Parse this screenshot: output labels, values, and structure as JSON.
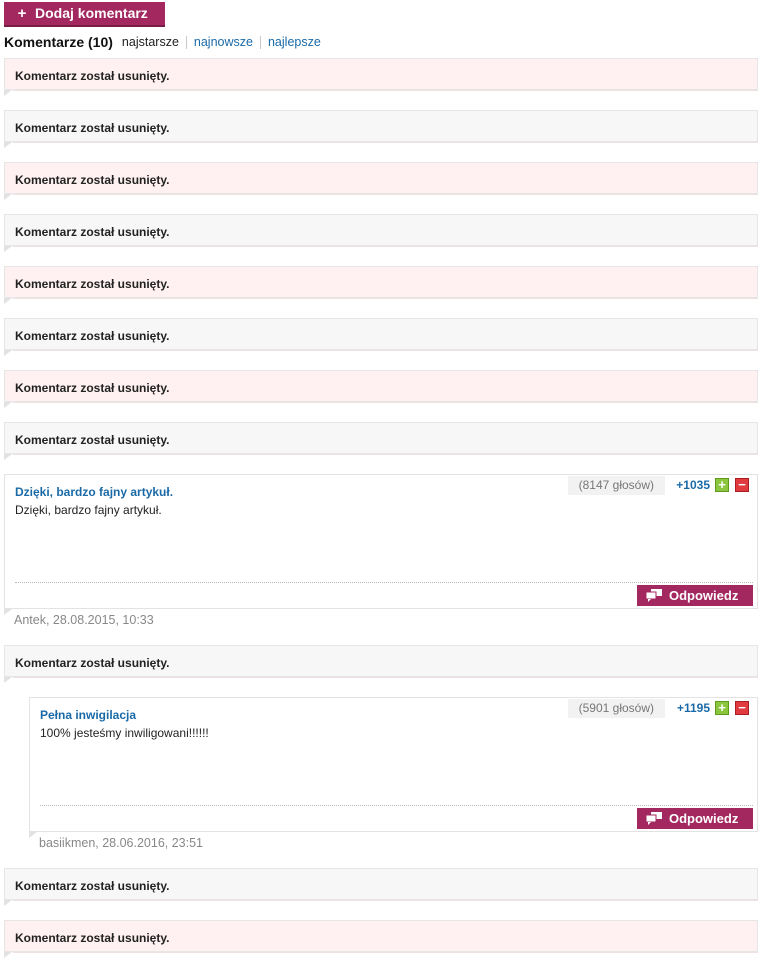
{
  "add_comment": {
    "icon": "plus-icon",
    "label": "Dodaj komentarz"
  },
  "comments_header": {
    "title": "Komentarze (10)",
    "sort_options": [
      "najstarsze",
      "najnowsze",
      "najlepsze"
    ]
  },
  "deleted_text": "Komentarz został usunięty.",
  "deleted_items": [
    "Komentarz został usunięty.",
    "Komentarz został usunięty.",
    "Komentarz został usunięty.",
    "Komentarz został usunięty.",
    "Komentarz został usunięty.",
    "Komentarz został usunięty.",
    "Komentarz został usunięty.",
    "Komentarz został usunięty.",
    "Komentarz został usunięty.",
    "Komentarz został usunięty.",
    "Komentarz został usunięty."
  ],
  "comments": [
    {
      "title": "Dzięki, bardzo fajny artykuł.",
      "body": "Dzięki, bardzo fajny artykuł.",
      "votes": "(8147 głosów)",
      "score": "+1035",
      "reply_label": "Odpowiedz",
      "author_line": "Antek, 28.08.2015, 10:33"
    },
    {
      "title": "Pełna inwigilacja",
      "body": "100% jesteśmy inwiligowani!!!!!!",
      "votes": "(5901 głosów)",
      "score": "+1195",
      "reply_label": "Odpowiedz",
      "author_line": "basiikmen, 28.06.2016, 23:51"
    }
  ],
  "icons": {
    "vote_up": "plus-icon",
    "vote_down": "minus-icon",
    "reply": "speech-bubble-icon"
  },
  "colors": {
    "accent": "#a3285f",
    "link": "#1a6aa8",
    "deleted_pink": "#fff1f1",
    "deleted_gray": "#f7f7f7",
    "vote_up": "#8cc63f",
    "vote_down": "#e0393e"
  }
}
